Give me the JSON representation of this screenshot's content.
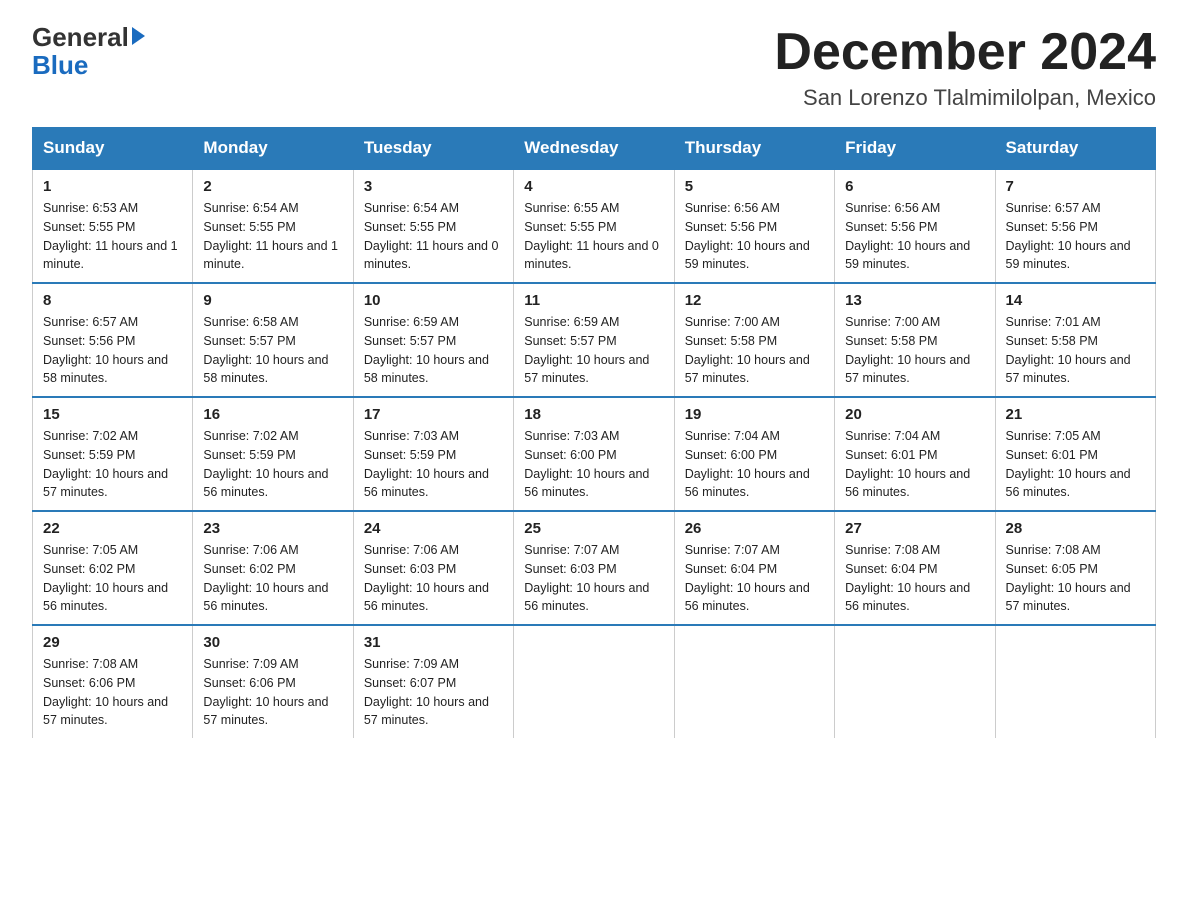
{
  "header": {
    "logo_general": "General",
    "logo_blue": "Blue",
    "month_title": "December 2024",
    "location": "San Lorenzo Tlalmimilolpan, Mexico"
  },
  "days_of_week": [
    "Sunday",
    "Monday",
    "Tuesday",
    "Wednesday",
    "Thursday",
    "Friday",
    "Saturday"
  ],
  "weeks": [
    [
      {
        "day": "1",
        "sunrise": "6:53 AM",
        "sunset": "5:55 PM",
        "daylight": "11 hours and 1 minute."
      },
      {
        "day": "2",
        "sunrise": "6:54 AM",
        "sunset": "5:55 PM",
        "daylight": "11 hours and 1 minute."
      },
      {
        "day": "3",
        "sunrise": "6:54 AM",
        "sunset": "5:55 PM",
        "daylight": "11 hours and 0 minutes."
      },
      {
        "day": "4",
        "sunrise": "6:55 AM",
        "sunset": "5:55 PM",
        "daylight": "11 hours and 0 minutes."
      },
      {
        "day": "5",
        "sunrise": "6:56 AM",
        "sunset": "5:56 PM",
        "daylight": "10 hours and 59 minutes."
      },
      {
        "day": "6",
        "sunrise": "6:56 AM",
        "sunset": "5:56 PM",
        "daylight": "10 hours and 59 minutes."
      },
      {
        "day": "7",
        "sunrise": "6:57 AM",
        "sunset": "5:56 PM",
        "daylight": "10 hours and 59 minutes."
      }
    ],
    [
      {
        "day": "8",
        "sunrise": "6:57 AM",
        "sunset": "5:56 PM",
        "daylight": "10 hours and 58 minutes."
      },
      {
        "day": "9",
        "sunrise": "6:58 AM",
        "sunset": "5:57 PM",
        "daylight": "10 hours and 58 minutes."
      },
      {
        "day": "10",
        "sunrise": "6:59 AM",
        "sunset": "5:57 PM",
        "daylight": "10 hours and 58 minutes."
      },
      {
        "day": "11",
        "sunrise": "6:59 AM",
        "sunset": "5:57 PM",
        "daylight": "10 hours and 57 minutes."
      },
      {
        "day": "12",
        "sunrise": "7:00 AM",
        "sunset": "5:58 PM",
        "daylight": "10 hours and 57 minutes."
      },
      {
        "day": "13",
        "sunrise": "7:00 AM",
        "sunset": "5:58 PM",
        "daylight": "10 hours and 57 minutes."
      },
      {
        "day": "14",
        "sunrise": "7:01 AM",
        "sunset": "5:58 PM",
        "daylight": "10 hours and 57 minutes."
      }
    ],
    [
      {
        "day": "15",
        "sunrise": "7:02 AM",
        "sunset": "5:59 PM",
        "daylight": "10 hours and 57 minutes."
      },
      {
        "day": "16",
        "sunrise": "7:02 AM",
        "sunset": "5:59 PM",
        "daylight": "10 hours and 56 minutes."
      },
      {
        "day": "17",
        "sunrise": "7:03 AM",
        "sunset": "5:59 PM",
        "daylight": "10 hours and 56 minutes."
      },
      {
        "day": "18",
        "sunrise": "7:03 AM",
        "sunset": "6:00 PM",
        "daylight": "10 hours and 56 minutes."
      },
      {
        "day": "19",
        "sunrise": "7:04 AM",
        "sunset": "6:00 PM",
        "daylight": "10 hours and 56 minutes."
      },
      {
        "day": "20",
        "sunrise": "7:04 AM",
        "sunset": "6:01 PM",
        "daylight": "10 hours and 56 minutes."
      },
      {
        "day": "21",
        "sunrise": "7:05 AM",
        "sunset": "6:01 PM",
        "daylight": "10 hours and 56 minutes."
      }
    ],
    [
      {
        "day": "22",
        "sunrise": "7:05 AM",
        "sunset": "6:02 PM",
        "daylight": "10 hours and 56 minutes."
      },
      {
        "day": "23",
        "sunrise": "7:06 AM",
        "sunset": "6:02 PM",
        "daylight": "10 hours and 56 minutes."
      },
      {
        "day": "24",
        "sunrise": "7:06 AM",
        "sunset": "6:03 PM",
        "daylight": "10 hours and 56 minutes."
      },
      {
        "day": "25",
        "sunrise": "7:07 AM",
        "sunset": "6:03 PM",
        "daylight": "10 hours and 56 minutes."
      },
      {
        "day": "26",
        "sunrise": "7:07 AM",
        "sunset": "6:04 PM",
        "daylight": "10 hours and 56 minutes."
      },
      {
        "day": "27",
        "sunrise": "7:08 AM",
        "sunset": "6:04 PM",
        "daylight": "10 hours and 56 minutes."
      },
      {
        "day": "28",
        "sunrise": "7:08 AM",
        "sunset": "6:05 PM",
        "daylight": "10 hours and 57 minutes."
      }
    ],
    [
      {
        "day": "29",
        "sunrise": "7:08 AM",
        "sunset": "6:06 PM",
        "daylight": "10 hours and 57 minutes."
      },
      {
        "day": "30",
        "sunrise": "7:09 AM",
        "sunset": "6:06 PM",
        "daylight": "10 hours and 57 minutes."
      },
      {
        "day": "31",
        "sunrise": "7:09 AM",
        "sunset": "6:07 PM",
        "daylight": "10 hours and 57 minutes."
      },
      null,
      null,
      null,
      null
    ]
  ],
  "labels": {
    "sunrise": "Sunrise:",
    "sunset": "Sunset:",
    "daylight": "Daylight:"
  }
}
